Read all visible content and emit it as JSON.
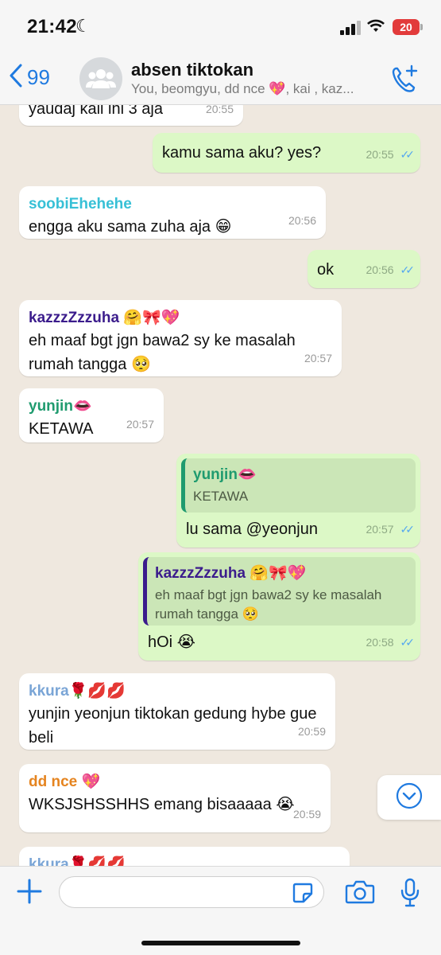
{
  "status_bar": {
    "time": "21:42",
    "battery": "20"
  },
  "header": {
    "back_count": "99",
    "title": "absen tiktokan",
    "subtitle": "You, beomgyu, dd nce 💖, kai , kaz..."
  },
  "messages": [
    {
      "text": "yaudaj kali ini 3 aja",
      "time": "20:55"
    },
    {
      "text": "kamu sama aku? yes?",
      "time": "20:55"
    },
    {
      "sender": "soobiEhehehe",
      "text": "engga aku sama zuha aja 😁",
      "time": "20:56"
    },
    {
      "text": "ok",
      "time": "20:56"
    },
    {
      "sender": "kazzzZzzuha 🤗🎀💖",
      "text": "eh maaf bgt jgn bawa2 sy ke masalah rumah tangga 🥺",
      "time": "20:57"
    },
    {
      "sender": "yunjin👄",
      "text": "KETAWA",
      "time": "20:57"
    },
    {
      "quote_name": "yunjin👄",
      "quote_text": "KETAWA",
      "text": "lu sama @yeonjun",
      "time": "20:57"
    },
    {
      "quote_name": "kazzzZzzuha 🤗🎀💖",
      "quote_text": "eh maaf bgt jgn bawa2 sy ke masalah rumah tangga 🥺",
      "text": "hOi 😭",
      "time": "20:58"
    },
    {
      "sender": "kkura🌹💋💋",
      "text": "yunjin yeonjun tiktokan gedung hybe gue beli",
      "time": "20:59"
    },
    {
      "sender": "dd nce 💖",
      "text": "WKSJSHSSHHS emang bisaaaaa 😭",
      "time": "20:59"
    },
    {
      "sender": "kkura🌹💋💋"
    }
  ],
  "input": {
    "placeholder": ""
  },
  "colors": {
    "accent": "#1f7ae0",
    "outgoing_bubble": "#dcf8c6",
    "incoming_bubble": "#ffffff",
    "sender_soobi": "#37c0d6",
    "sender_kazzz": "#3b1c8c",
    "sender_yunjin": "#1f9b6f",
    "sender_kkura": "#7aa5d6",
    "sender_ddnce": "#e5841f"
  },
  "icons": [
    "chevron-left-icon",
    "group-avatar-icon",
    "add-call-icon",
    "chevron-down-icon",
    "plus-icon",
    "sticker-icon",
    "camera-icon",
    "microphone-icon"
  ]
}
